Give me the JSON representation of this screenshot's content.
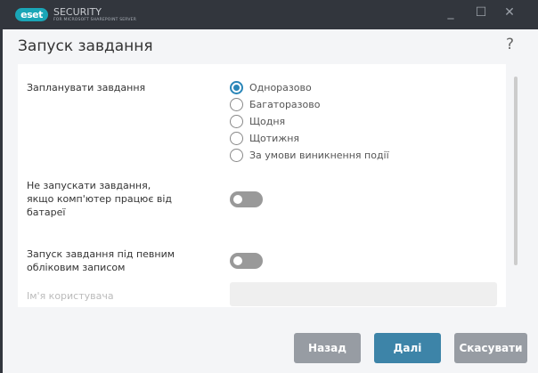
{
  "app": {
    "logo": "eset",
    "brand": "SECURITY",
    "brand_sub": "FOR MICROSOFT SHAREPOINT SERVER"
  },
  "window_controls": {
    "minimize": "_",
    "maximize": "☐",
    "close": "✕"
  },
  "page": {
    "title": "Запуск завдання",
    "help": "?"
  },
  "schedule": {
    "label": "Запланувати завдання",
    "options": [
      "Одноразово",
      "Багаторазово",
      "Щодня",
      "Щотижня",
      "За умови виникнення події"
    ],
    "selected": 0
  },
  "battery": {
    "label": "Не запускати завдання, якщо комп'ютер працює від батареї",
    "on": false
  },
  "account": {
    "label": "Запуск завдання під певним обліковим записом",
    "on": false
  },
  "username": {
    "label": "Ім'я користувача",
    "value": ""
  },
  "buttons": {
    "back": "Назад",
    "next": "Далі",
    "cancel": "Скасувати"
  }
}
